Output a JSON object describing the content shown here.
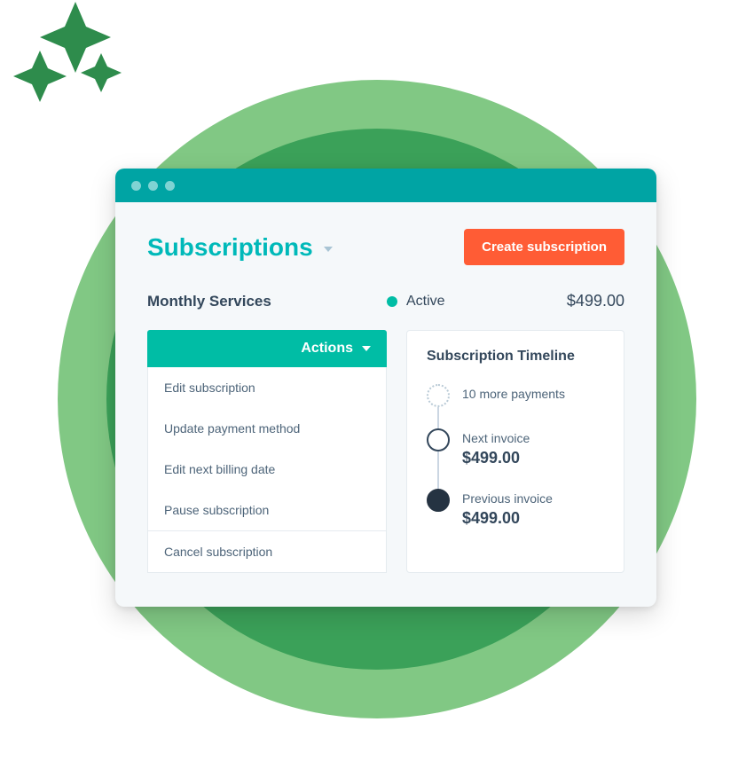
{
  "header": {
    "title": "Subscriptions",
    "create_button": "Create subscription"
  },
  "subscription": {
    "name": "Monthly Services",
    "status": "Active",
    "amount": "$499.00"
  },
  "actions": {
    "header": "Actions",
    "items": [
      "Edit subscription",
      "Update payment method",
      "Edit next billing date",
      "Pause subscription",
      "Cancel subscription"
    ]
  },
  "timeline": {
    "title": "Subscription Timeline",
    "items": [
      {
        "label": "10 more payments",
        "amount": ""
      },
      {
        "label": "Next invoice",
        "amount": "$499.00"
      },
      {
        "label": "Previous invoice",
        "amount": "$499.00"
      }
    ]
  },
  "colors": {
    "accent": "#00bda5",
    "cta": "#ff5c35",
    "text": "#33475b"
  }
}
